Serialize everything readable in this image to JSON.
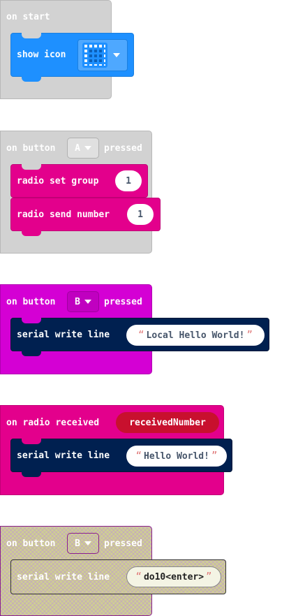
{
  "blocks": {
    "on_start": {
      "label": "on start"
    },
    "show_icon": {
      "label": "show icon"
    },
    "button_a": {
      "prefix": "on button",
      "button": "A",
      "suffix": "pressed"
    },
    "radio_set_group": {
      "label": "radio set group",
      "value": "1"
    },
    "radio_send_number": {
      "label": "radio send number",
      "value": "1"
    },
    "button_b": {
      "prefix": "on button",
      "button": "B",
      "suffix": "pressed"
    },
    "serial_local": {
      "label": "serial write line",
      "value": "Local Hello World!"
    },
    "radio_received": {
      "prefix": "on radio received",
      "variable": "receivedNumber"
    },
    "serial_hello": {
      "label": "serial write line",
      "value": "Hello World!"
    },
    "button_b_disabled": {
      "prefix": "on button",
      "button": "B",
      "suffix": "pressed"
    },
    "serial_do10": {
      "label": "serial write line",
      "value": "do10<enter>"
    }
  },
  "quote_open": "“",
  "quote_close": "”",
  "colors": {
    "hat_gray": "#d2d2d2",
    "basic_blue": "#1e90ff",
    "radio_pink": "#e3008c",
    "input_magenta": "#d400d4",
    "serial_navy": "#002050",
    "variable_red": "#c8102e",
    "disabled_olive": "#c9c890"
  }
}
